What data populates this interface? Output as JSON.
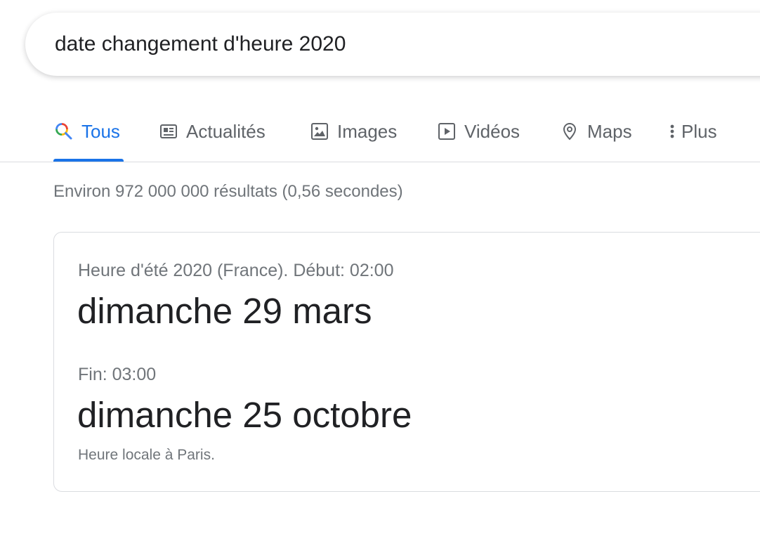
{
  "search": {
    "query": "date changement d'heure 2020"
  },
  "tabs": [
    {
      "label": "Tous",
      "icon": "search-icon",
      "active": true
    },
    {
      "label": "Actualités",
      "icon": "news-icon",
      "active": false
    },
    {
      "label": "Images",
      "icon": "image-icon",
      "active": false
    },
    {
      "label": "Vidéos",
      "icon": "video-play-icon",
      "active": false
    },
    {
      "label": "Maps",
      "icon": "map-pin-icon",
      "active": false
    },
    {
      "label": "Plus",
      "icon": "more-vert-icon",
      "active": false
    }
  ],
  "results_stats": "Environ 972 000 000 résultats (0,56 secondes)",
  "answer_card": {
    "start_label": "Heure d'été 2020 (France). Début: 02:00",
    "start_date": "dimanche 29 mars",
    "end_label": "Fin: 03:00",
    "end_date": "dimanche 25 octobre",
    "footnote": "Heure locale à Paris."
  },
  "colors": {
    "accent": "#1a73e8",
    "secondary_text": "#70757a",
    "tab_text": "#5f6368",
    "primary_text": "#202124",
    "divider": "#dadce0"
  }
}
